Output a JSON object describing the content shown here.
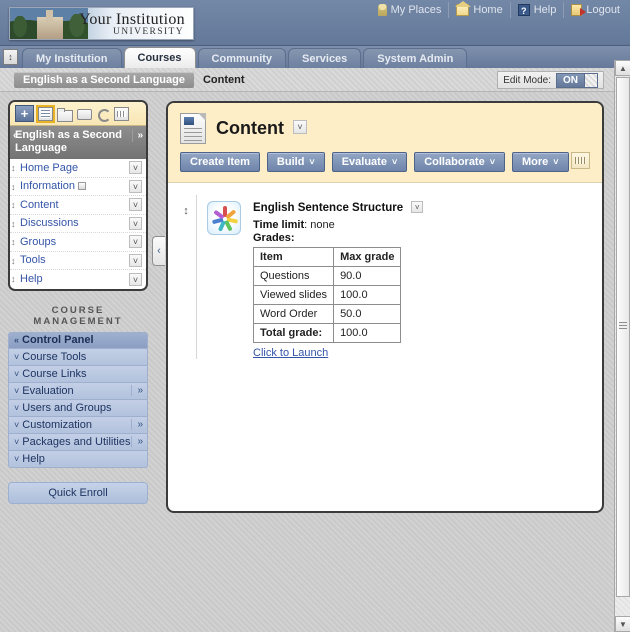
{
  "header": {
    "logo": {
      "institution": "Your Institution",
      "subtitle": "UNIVERSITY"
    },
    "nav": [
      {
        "label": "My Places",
        "icon": "person-icon"
      },
      {
        "label": "Home",
        "icon": "house-icon"
      },
      {
        "label": "Help",
        "icon": "question-icon"
      },
      {
        "label": "Logout",
        "icon": "logout-icon"
      }
    ]
  },
  "tabs": [
    {
      "label": "My Institution",
      "active": false
    },
    {
      "label": "Courses",
      "active": true
    },
    {
      "label": "Community",
      "active": false
    },
    {
      "label": "Services",
      "active": false
    },
    {
      "label": "System Admin",
      "active": false
    }
  ],
  "breadcrumb": {
    "course": "English as a Second Language",
    "current": "Content",
    "edit_mode_label": "Edit Mode:",
    "edit_mode_value": "ON"
  },
  "course_menu": {
    "toolbar": [
      {
        "icon": "plus-icon",
        "label": "+"
      },
      {
        "icon": "list-view-icon",
        "selected": true
      },
      {
        "icon": "folder-view-icon",
        "selected": false
      },
      {
        "icon": "display-view-icon",
        "selected": false
      },
      {
        "icon": "refresh-icon",
        "selected": false
      },
      {
        "icon": "keyboard-accessible-icon",
        "selected": false
      }
    ],
    "title": "English as a Second Language",
    "collapse_caret": "«",
    "expand_caret": "»",
    "items": [
      {
        "label": "Home Page",
        "badge": false
      },
      {
        "label": "Information",
        "badge": true
      },
      {
        "label": "Content",
        "badge": false
      },
      {
        "label": "Discussions",
        "badge": false
      },
      {
        "label": "Groups",
        "badge": false
      },
      {
        "label": "Tools",
        "badge": false
      },
      {
        "label": "Help",
        "badge": false
      }
    ]
  },
  "course_management": {
    "heading": "COURSE MANAGEMENT",
    "items": [
      {
        "label": "Control Panel",
        "caret": "«",
        "more": false,
        "header": true
      },
      {
        "label": "Course Tools",
        "caret": "ˇ",
        "more": false,
        "header": false
      },
      {
        "label": "Course Links",
        "caret": "ˇ",
        "more": false,
        "header": false
      },
      {
        "label": "Evaluation",
        "caret": "ˇ",
        "more": true,
        "header": false
      },
      {
        "label": "Users and Groups",
        "caret": "ˇ",
        "more": false,
        "header": false
      },
      {
        "label": "Customization",
        "caret": "ˇ",
        "more": true,
        "header": false
      },
      {
        "label": "Packages and Utilities",
        "caret": "ˇ",
        "more": true,
        "header": false
      },
      {
        "label": "Help",
        "caret": "ˇ",
        "more": false,
        "header": false
      }
    ],
    "quick_enroll": "Quick Enroll"
  },
  "collapse_handle": "‹",
  "content": {
    "title": "Content",
    "title_icon": "document-icon",
    "actions": [
      {
        "label": "Create Item",
        "has_chevron": false
      },
      {
        "label": "Build",
        "has_chevron": true
      },
      {
        "label": "Evaluate",
        "has_chevron": true
      },
      {
        "label": "Collaborate",
        "has_chevron": true
      },
      {
        "label": "More",
        "has_chevron": true
      }
    ],
    "item": {
      "icon": "pinwheel-icon",
      "title": "English Sentence Structure",
      "time_limit_label": "Time limit",
      "time_limit_value": "none",
      "grades_label": "Grades:",
      "grades_table": {
        "columns": [
          "Item",
          "Max grade"
        ],
        "rows": [
          [
            "Questions",
            "90.0"
          ],
          [
            "Viewed slides",
            "100.0"
          ],
          [
            "Word Order",
            "50.0"
          ],
          [
            "Total grade:",
            "100.0"
          ]
        ]
      },
      "launch_link": "Click to Launch"
    }
  },
  "colors": {
    "topbar": "#6b7f9e",
    "panel_header": "#fdeec8",
    "button": "#7d93bd",
    "link": "#3354a8",
    "control_panel": "#b3c2dd"
  }
}
